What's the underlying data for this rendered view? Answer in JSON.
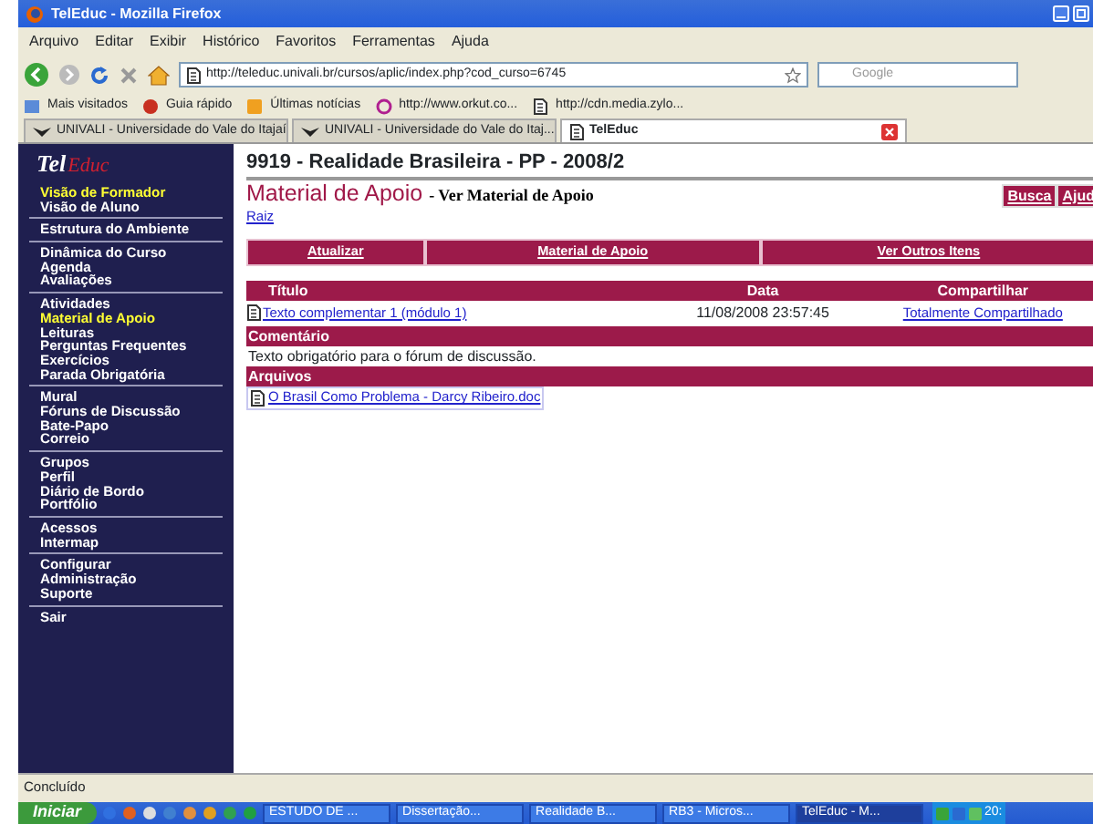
{
  "window": {
    "title": "TelEduc - Mozilla Firefox"
  },
  "menu": [
    "Arquivo",
    "Editar",
    "Exibir",
    "Histórico",
    "Favoritos",
    "Ferramentas",
    "Ajuda"
  ],
  "address": {
    "url": "http://teleduc.univali.br/cursos/aplic/index.php?cod_curso=6745"
  },
  "search": {
    "placeholder": "Google"
  },
  "bookmarks": [
    "Mais visitados",
    "Guia rápido",
    "Últimas notícias",
    "http://www.orkut.co...",
    "http://cdn.media.zylo..."
  ],
  "tabs": [
    {
      "label": "UNIVALI - Universidade do Vale do Itajaí",
      "selected": false
    },
    {
      "label": "UNIVALI - Universidade do Vale do Itaj...",
      "selected": false
    },
    {
      "label": "TelEduc",
      "selected": true
    }
  ],
  "sidebar": {
    "logo": [
      "Tel",
      "Educ"
    ],
    "groups": [
      [
        {
          "label": "Visão de Formador",
          "selected": true
        },
        {
          "label": "Visão de Aluno",
          "selected": false
        }
      ],
      [
        {
          "label": "Estrutura do Ambiente",
          "selected": false
        }
      ],
      [
        {
          "label": "Dinâmica do Curso",
          "selected": false
        },
        {
          "label": "Agenda",
          "selected": false
        },
        {
          "label": "Avaliações",
          "selected": false
        }
      ],
      [
        {
          "label": "Atividades",
          "selected": false
        },
        {
          "label": "Material de Apoio",
          "selected": true
        },
        {
          "label": "Leituras",
          "selected": false
        },
        {
          "label": "Perguntas Frequentes",
          "selected": false
        },
        {
          "label": "Exercícios",
          "selected": false
        },
        {
          "label": "Parada Obrigatória",
          "selected": false
        }
      ],
      [
        {
          "label": "Mural",
          "selected": false
        },
        {
          "label": "Fóruns de Discussão",
          "selected": false
        },
        {
          "label": "Bate-Papo",
          "selected": false
        },
        {
          "label": "Correio",
          "selected": false
        }
      ],
      [
        {
          "label": "Grupos",
          "selected": false
        },
        {
          "label": "Perfil",
          "selected": false
        },
        {
          "label": "Diário de Bordo",
          "selected": false
        },
        {
          "label": "Portfólio",
          "selected": false
        }
      ],
      [
        {
          "label": "Acessos",
          "selected": false
        },
        {
          "label": "Intermap",
          "selected": false
        }
      ],
      [
        {
          "label": "Configurar",
          "selected": false
        },
        {
          "label": "Administração",
          "selected": false
        },
        {
          "label": "Suporte",
          "selected": false
        }
      ],
      [
        {
          "label": "Sair",
          "selected": false
        }
      ]
    ]
  },
  "page": {
    "course": "9919 - Realidade Brasileira - PP - 2008/2",
    "heading": "Material de Apoio",
    "subheading": "- Ver Material de Apoio",
    "breadcrumb": "Raiz",
    "header_buttons": [
      "Busca",
      "Ajud"
    ],
    "actions": [
      "Atualizar",
      "Material de Apoio",
      "Ver Outros Itens"
    ],
    "table": {
      "columns": [
        "Título",
        "Data",
        "Compartilhar"
      ],
      "rows": [
        {
          "title": "Texto complementar 1 (módulo 1)",
          "date": "11/08/2008 23:57:45",
          "sharing": "Totalmente Compartilhado"
        }
      ]
    },
    "comment": {
      "label": "Comentário",
      "text": "Texto obrigatório para o fórum de discussão."
    },
    "files": {
      "label": "Arquivos",
      "items": [
        "O Brasil Como Problema - Darcy Ribeiro.doc"
      ]
    }
  },
  "status_bar": "Concluído",
  "taskbar": {
    "start": "Iniciar",
    "items": [
      {
        "label": "ESTUDO DE ...",
        "selected": false
      },
      {
        "label": "Dissertação...",
        "selected": false
      },
      {
        "label": "Realidade B...",
        "selected": false
      },
      {
        "label": "RB3 - Micros...",
        "selected": false
      },
      {
        "label": "TelEduc - M...",
        "selected": true
      }
    ],
    "clock": "20:"
  }
}
